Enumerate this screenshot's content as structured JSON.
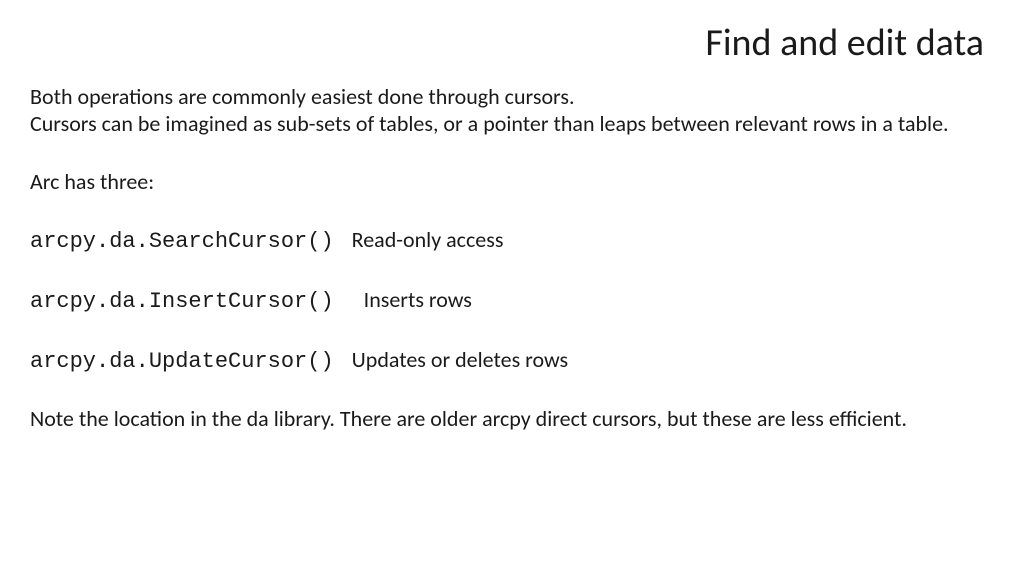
{
  "title": "Find and edit data",
  "intro1": "Both operations are commonly easiest done through cursors.",
  "intro2": "Cursors can be imagined as sub-sets of tables, or a pointer than leaps between relevant rows in a table.",
  "arc_has": "Arc has three:",
  "cursors": [
    {
      "code": "arcpy.da.SearchCursor()",
      "desc": "Read-only access"
    },
    {
      "code": "arcpy.da.InsertCursor()",
      "desc": "Inserts rows"
    },
    {
      "code": "arcpy.da.UpdateCursor()",
      "desc": "Updates or deletes rows"
    }
  ],
  "note": "Note the location in the da library. There are older arcpy direct cursors, but these are less efficient."
}
